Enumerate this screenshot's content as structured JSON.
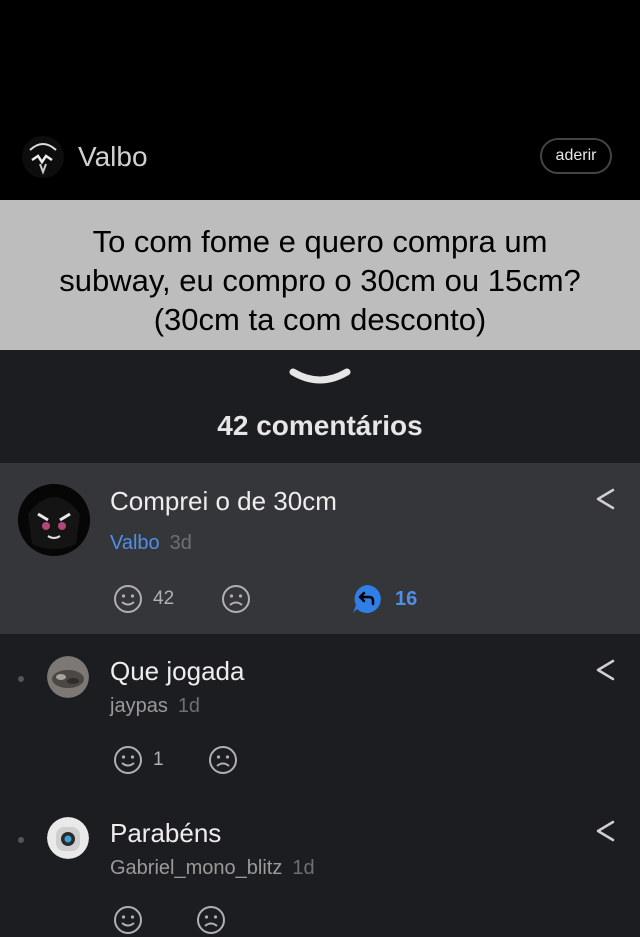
{
  "post": {
    "author": "Valbo",
    "join_label": "aderir",
    "question_lines": [
      "To com fome e quero compra um",
      "subway, eu compro o 30cm ou 15cm?",
      "(30cm ta com desconto)"
    ],
    "comments_count_label": "42 comentários"
  },
  "main_comment": {
    "text": "Comprei o de 30cm",
    "user": "Valbo",
    "time": "3d",
    "likes": "42",
    "replies": "16"
  },
  "replies": [
    {
      "text": "Que jogada",
      "user": "jaypas",
      "time": "1d",
      "likes": "1"
    },
    {
      "text": "Parabéns",
      "user": "Gabriel_mono_blitz",
      "time": "1d",
      "likes": ""
    }
  ],
  "colors": {
    "accent": "#4f8fe8",
    "question_bg": "#bdbdbd",
    "highlight_bg": "#35363a",
    "list_bg": "#1c1d21"
  },
  "icons": [
    "share-icon",
    "smile-icon",
    "sad-icon",
    "reply-icon",
    "chevron-down-icon"
  ]
}
